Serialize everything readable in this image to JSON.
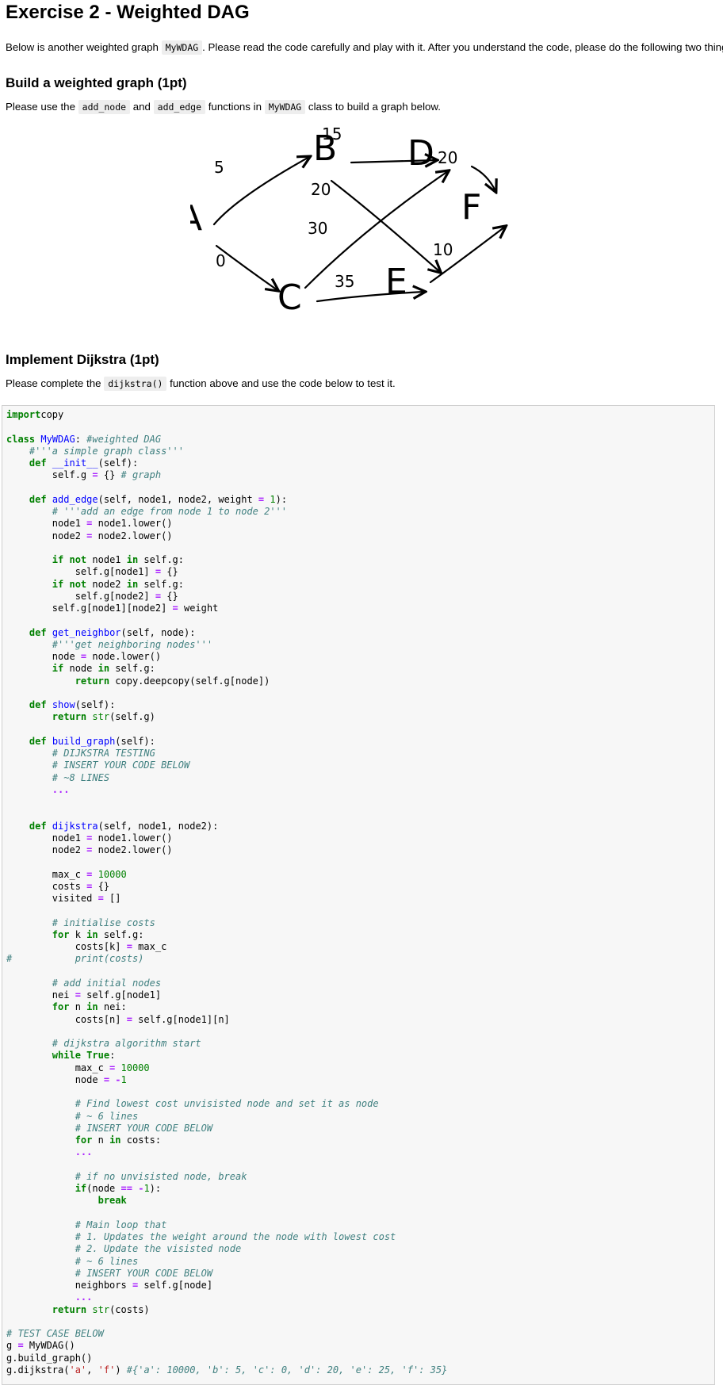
{
  "title": "Exercise 2 - Weighted DAG",
  "intro": {
    "before": "Below is another weighted graph ",
    "code": "MyWDAG",
    "after": ". Please read the code carefully and play with it. After you understand the code, please do the following two things:"
  },
  "section1": {
    "heading": "Build a weighted graph (1pt)",
    "p1": "Please use the ",
    "c1": "add_node",
    "p2": " and ",
    "c2": "add_edge",
    "p3": " functions in ",
    "c3": "MyWDAG",
    "p4": " class to build a graph below."
  },
  "graph": {
    "nodes": [
      "A",
      "B",
      "C",
      "D",
      "E",
      "F"
    ],
    "edges": [
      {
        "from": "A",
        "to": "B",
        "weight": "5"
      },
      {
        "from": "A",
        "to": "C",
        "weight": "0"
      },
      {
        "from": "B",
        "to": "D",
        "weight": "15"
      },
      {
        "from": "B",
        "to": "E",
        "weight": "20"
      },
      {
        "from": "C",
        "to": "D",
        "weight": "30"
      },
      {
        "from": "C",
        "to": "E",
        "weight": "35"
      },
      {
        "from": "D",
        "to": "F",
        "weight": "20"
      },
      {
        "from": "E",
        "to": "F",
        "weight": "10"
      }
    ]
  },
  "section2": {
    "heading": "Implement Dijkstra (1pt)",
    "p1": "Please complete the ",
    "c1": "dijkstra()",
    "p2": " function above and use the code below to test it."
  },
  "code_lines": [
    [
      [
        "kw",
        "import"
      ],
      [
        "",
        "copy"
      ]
    ],
    [],
    [
      [
        "kw",
        "class"
      ],
      [
        "",
        ""
      ],
      [
        "fn",
        " MyWDAG"
      ],
      [
        "",
        ": "
      ],
      [
        "cm",
        "#weighted DAG"
      ]
    ],
    [
      [
        "",
        "    "
      ],
      [
        "cm",
        "#'''a simple graph class'''"
      ]
    ],
    [
      [
        "",
        "    "
      ],
      [
        "kw",
        "def"
      ],
      [
        "fn",
        " __init__"
      ],
      [
        "",
        "(self):"
      ]
    ],
    [
      [
        "",
        "        self.g "
      ],
      [
        "op",
        "="
      ],
      [
        "",
        "",
        " "
      ],
      [
        "",
        "{} "
      ],
      [
        "cm",
        "# graph"
      ]
    ],
    [],
    [
      [
        "",
        "    "
      ],
      [
        "kw",
        "def"
      ],
      [
        "fn",
        " add_edge"
      ],
      [
        "",
        "(self, node1, node2, weight "
      ],
      [
        "op",
        "="
      ],
      [
        "nu",
        " 1"
      ],
      [
        "",
        "):"
      ]
    ],
    [
      [
        "",
        "        "
      ],
      [
        "cm",
        "# '''add an edge from node 1 to node 2'''"
      ]
    ],
    [
      [
        "",
        "        node1 "
      ],
      [
        "op",
        "="
      ],
      [
        "",
        "",
        " node1.lower()"
      ]
    ],
    [
      [
        "",
        "        node2 "
      ],
      [
        "op",
        "="
      ],
      [
        "",
        "",
        " node2.lower()"
      ]
    ],
    [],
    [
      [
        "",
        "        "
      ],
      [
        "kw",
        "if"
      ],
      [
        "",
        "",
        " "
      ],
      [
        "kw",
        "not"
      ],
      [
        "",
        "",
        " node1 "
      ],
      [
        "kw",
        "in"
      ],
      [
        "",
        "",
        " self.g:"
      ]
    ],
    [
      [
        "",
        "            self.g[node1] "
      ],
      [
        "op",
        "="
      ],
      [
        "",
        "",
        " {}"
      ]
    ],
    [
      [
        "",
        "        "
      ],
      [
        "kw",
        "if"
      ],
      [
        "",
        "",
        " "
      ],
      [
        "kw",
        "not"
      ],
      [
        "",
        "",
        " node2 "
      ],
      [
        "kw",
        "in"
      ],
      [
        "",
        "",
        " self.g:"
      ]
    ],
    [
      [
        "",
        "            self.g[node2] "
      ],
      [
        "op",
        "="
      ],
      [
        "",
        "",
        " {}"
      ]
    ],
    [
      [
        "",
        "        self.g[node1][node2] "
      ],
      [
        "op",
        "="
      ],
      [
        "",
        "",
        " weight"
      ]
    ],
    [],
    [
      [
        "",
        "    "
      ],
      [
        "kw",
        "def"
      ],
      [
        "fn",
        " get_neighbor"
      ],
      [
        "",
        "(self, node):"
      ]
    ],
    [
      [
        "",
        "        "
      ],
      [
        "cm",
        "#'''get neighboring nodes'''"
      ]
    ],
    [
      [
        "",
        "        node "
      ],
      [
        "op",
        "="
      ],
      [
        "",
        "",
        " node.lower()"
      ]
    ],
    [
      [
        "",
        "        "
      ],
      [
        "kw",
        "if"
      ],
      [
        "",
        "",
        " node "
      ],
      [
        "kw",
        "in"
      ],
      [
        "",
        "",
        " self.g:"
      ]
    ],
    [
      [
        "",
        "            "
      ],
      [
        "kw",
        "return"
      ],
      [
        "",
        "",
        " copy.deepcopy(self.g[node])"
      ]
    ],
    [],
    [
      [
        "",
        "    "
      ],
      [
        "kw",
        "def"
      ],
      [
        "fn",
        " show"
      ],
      [
        "",
        "(self):"
      ]
    ],
    [
      [
        "",
        "        "
      ],
      [
        "kw",
        "return"
      ],
      [
        "",
        "",
        " "
      ],
      [
        "bi",
        "str"
      ],
      [
        "",
        "(self.g)"
      ]
    ],
    [],
    [
      [
        "",
        "    "
      ],
      [
        "kw",
        "def"
      ],
      [
        "fn",
        " build_graph"
      ],
      [
        "",
        "(self):"
      ]
    ],
    [
      [
        "",
        "        "
      ],
      [
        "cm",
        "# DIJKSTRA TESTING"
      ]
    ],
    [
      [
        "",
        "        "
      ],
      [
        "cm",
        "# INSERT YOUR CODE BELOW"
      ]
    ],
    [
      [
        "",
        "        "
      ],
      [
        "cm",
        "# ~8 LINES"
      ]
    ],
    [
      [
        "",
        "        "
      ],
      [
        "op",
        "..."
      ]
    ],
    [],
    [],
    [
      [
        "",
        "    "
      ],
      [
        "kw",
        "def"
      ],
      [
        "fn",
        " dijkstra"
      ],
      [
        "",
        "(self, node1, node2):"
      ]
    ],
    [
      [
        "",
        "        node1 "
      ],
      [
        "op",
        "="
      ],
      [
        "",
        "",
        " node1.lower()"
      ]
    ],
    [
      [
        "",
        "        node2 "
      ],
      [
        "op",
        "="
      ],
      [
        "",
        "",
        " node2.lower()"
      ]
    ],
    [],
    [
      [
        "",
        "        max_c "
      ],
      [
        "op",
        "="
      ],
      [
        "nu",
        " 10000"
      ]
    ],
    [
      [
        "",
        "        costs "
      ],
      [
        "op",
        "="
      ],
      [
        "",
        "",
        " {}"
      ]
    ],
    [
      [
        "",
        "        visited "
      ],
      [
        "op",
        "="
      ],
      [
        "",
        "",
        " []"
      ]
    ],
    [],
    [
      [
        "",
        "        "
      ],
      [
        "cm",
        "# initialise costs"
      ]
    ],
    [
      [
        "",
        "        "
      ],
      [
        "kw",
        "for"
      ],
      [
        "",
        "",
        " k "
      ],
      [
        "kw",
        "in"
      ],
      [
        "",
        "",
        " self.g:"
      ]
    ],
    [
      [
        "",
        "            costs[k] "
      ],
      [
        "op",
        "="
      ],
      [
        "",
        "",
        " max_c"
      ]
    ],
    [
      [
        "cm",
        "#           print(costs)"
      ]
    ],
    [],
    [
      [
        "",
        "        "
      ],
      [
        "cm",
        "# add initial nodes"
      ]
    ],
    [
      [
        "",
        "        nei "
      ],
      [
        "op",
        "="
      ],
      [
        "",
        "",
        " self.g[node1]"
      ]
    ],
    [
      [
        "",
        "        "
      ],
      [
        "kw",
        "for"
      ],
      [
        "",
        "",
        " n "
      ],
      [
        "kw",
        "in"
      ],
      [
        "",
        "",
        " nei:"
      ]
    ],
    [
      [
        "",
        "            costs[n] "
      ],
      [
        "op",
        "="
      ],
      [
        "",
        "",
        " self.g[node1][n]"
      ]
    ],
    [],
    [
      [
        "",
        "        "
      ],
      [
        "cm",
        "# dijkstra algorithm start"
      ]
    ],
    [
      [
        "",
        "        "
      ],
      [
        "kw",
        "while"
      ],
      [
        "",
        "",
        " "
      ],
      [
        "kw",
        "True"
      ],
      [
        "",
        ":"
      ]
    ],
    [
      [
        "",
        "            max_c "
      ],
      [
        "op",
        "="
      ],
      [
        "nu",
        " 10000"
      ]
    ],
    [
      [
        "",
        "            node "
      ],
      [
        "op",
        "="
      ],
      [
        "",
        "",
        " "
      ],
      [
        "op",
        "-"
      ],
      [
        "nu",
        "1"
      ]
    ],
    [],
    [
      [
        "",
        "            "
      ],
      [
        "cm",
        "# Find lowest cost unvisisted node and set it as node"
      ]
    ],
    [
      [
        "",
        "            "
      ],
      [
        "cm",
        "# ~ 6 lines"
      ]
    ],
    [
      [
        "",
        "            "
      ],
      [
        "cm",
        "# INSERT YOUR CODE BELOW"
      ]
    ],
    [
      [
        "",
        "            "
      ],
      [
        "kw",
        "for"
      ],
      [
        "",
        "",
        " n "
      ],
      [
        "kw",
        "in"
      ],
      [
        "",
        "",
        " costs:"
      ]
    ],
    [
      [
        "",
        "            "
      ],
      [
        "op",
        "..."
      ]
    ],
    [],
    [
      [
        "",
        "            "
      ],
      [
        "cm",
        "# if no unvisisted node, break"
      ]
    ],
    [
      [
        "",
        "            "
      ],
      [
        "kw",
        "if"
      ],
      [
        "",
        "(node "
      ],
      [
        "op",
        "=="
      ],
      [
        "",
        "",
        " "
      ],
      [
        "op",
        "-"
      ],
      [
        "nu",
        "1"
      ],
      [
        "",
        "):"
      ]
    ],
    [
      [
        "",
        "                "
      ],
      [
        "kw",
        "break"
      ]
    ],
    [],
    [
      [
        "",
        "            "
      ],
      [
        "cm",
        "# Main loop that"
      ]
    ],
    [
      [
        "",
        "            "
      ],
      [
        "cm",
        "# 1. Updates the weight around the node with lowest cost"
      ]
    ],
    [
      [
        "",
        "            "
      ],
      [
        "cm",
        "# 2. Update the visisted node"
      ]
    ],
    [
      [
        "",
        "            "
      ],
      [
        "cm",
        "# ~ 6 lines"
      ]
    ],
    [
      [
        "",
        "            "
      ],
      [
        "cm",
        "# INSERT YOUR CODE BELOW"
      ]
    ],
    [
      [
        "",
        "            neighbors "
      ],
      [
        "op",
        "="
      ],
      [
        "",
        "",
        " self.g[node]"
      ]
    ],
    [
      [
        "",
        "            "
      ],
      [
        "op",
        "..."
      ]
    ],
    [
      [
        "",
        "        "
      ],
      [
        "kw",
        "return"
      ],
      [
        "",
        "",
        " "
      ],
      [
        "bi",
        "str"
      ],
      [
        "",
        "(costs)"
      ]
    ],
    [],
    [
      [
        "cm",
        "# TEST CASE BELOW"
      ]
    ],
    [
      [
        "",
        "g "
      ],
      [
        "op",
        "="
      ],
      [
        "",
        "",
        " MyWDAG()"
      ]
    ],
    [
      [
        "",
        "g.build_graph()"
      ]
    ],
    [
      [
        "",
        "g.dijkstra("
      ],
      [
        "st",
        "'a'"
      ],
      [
        "",
        ", "
      ],
      [
        "st",
        "'f'"
      ],
      [
        "",
        ") "
      ],
      [
        "cm",
        "#{'a': 10000, 'b': 5, 'c': 0, 'd': 20, 'e': 25, 'f': 35}"
      ]
    ]
  ]
}
